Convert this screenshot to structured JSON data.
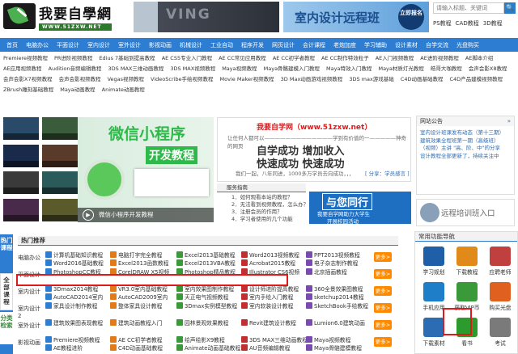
{
  "header": {
    "logo_title": "我要自學網",
    "logo_url": "WWW.51ZXW.NET",
    "banner1_text": "VING",
    "banner2_text": "室内设计远程班",
    "banner2_button": "立即报名",
    "search_placeholder": "请输入标题、关键词",
    "search_icon": "🔍",
    "quicklinks": [
      "PS教程",
      "CAD教程",
      "3D教程"
    ]
  },
  "nav": [
    "首页",
    "电脑办公",
    "平面设计",
    "室内设计",
    "室外设计",
    "影视动画",
    "机械设计",
    "工业自动",
    "程序开发",
    "网页设计",
    "会计课程",
    "老炮加度",
    "学习辅助",
    "设计素材",
    "自学交流",
    "光盘购买"
  ],
  "subnav": [
    "Premiere视频教程",
    "PR进阶视频教程",
    "Edius 7基础到提高教程",
    "AE CS5专业入门教程",
    "AE CC常见应用教程",
    "AE CC初学者教程",
    "AE CC制作特效粒子",
    "AE入门视频教程",
    "AE进阶视频教程",
    "AE脚本介绍",
    "AE应用视频教程",
    "Audition音频编辑教程",
    "3DS MAX三维动画教程",
    "3DS MAX视频教程",
    "Maya视频教程",
    "Maya骨骼建模入门教程",
    "Maya特效入门教程",
    "Maya材质灯光教程",
    "皓哥大咖教程",
    "会声会影X8教程",
    "会声会影X7视频教程",
    "会声会影视频教程",
    "Vegas视频教程",
    "VideoScribe手绘视频教程",
    "Movie Maker视频教程",
    "3D Max动画游戏视频教程",
    "3DS max游戏基础",
    "C4D动画基础教程",
    "C4D产品建模视频教程",
    "ZBrush雕刻基础教程",
    "Maya动画教程",
    "Animate动画教程"
  ],
  "hero": {
    "title": "微信小程序",
    "subtitle": "开发教程",
    "caption": "微信小程序开发教程",
    "play_icon": "▶"
  },
  "promo": {
    "title": "我要自学网（www.51zxw.net）",
    "tagline": "让任何人都可以—————————————学到有价值的一—————神奇的网页",
    "head1": "自学成功  增加收入",
    "head2": "快速成功  快速成功",
    "footer": "我们一起，八年同进，1000多万学员去向成功，，，",
    "link": "[ 分享：学员感言 ]"
  },
  "guide": {
    "heading": "服务指南",
    "items": [
      "1．如何观看本站的教程？",
      "2．无法看到视频教程，怎么办？",
      "3．注册会员的作用？",
      "4．学习者使用的几个功能"
    ],
    "ad_title": "与您同行",
    "ad_sub1": "我要自学网助力大学生",
    "ad_sub2": "开展校园活动"
  },
  "notice": {
    "heading": "网站公告",
    "more": "»",
    "items": [
      "室内设计班课发布动态（第十三期）",
      "建筑效果全程班第一期（高级班）",
      "（视频）主讲 \"高、阶、中\"的分享",
      "设计教程全部更新了，持续关注中"
    ]
  },
  "train": {
    "label": "远程培训班入口",
    "icon": "👤"
  },
  "side": {
    "hot": "热门课程",
    "all": "全部课程",
    "cat": "分类检索"
  },
  "hot": {
    "heading": "热门推荐",
    "more": "更多>",
    "rows": [
      {
        "cat": "电脑办公",
        "items": [
          "计算机基础知识教程",
          "电脑打字完全教程",
          "Excel2013基础教程",
          "Word2013视频教程",
          "PPT2013视频教程"
        ],
        "items2": [
          "Word2016基础教程",
          "Excel2013函数教程",
          "Excel2013VBA教程",
          "Acrobat2015教程",
          "电子杂志制作教程"
        ]
      },
      {
        "cat": "平面设计",
        "items": [
          "PhotoshopCC教程",
          "CorelDRAW X5视频",
          "Photoshop精品教程",
          "Illustrator CS6视频",
          "北京插画教程"
        ],
        "items2": []
      },
      {
        "cat": "室内设计",
        "items": [
          "3Dmax2014教程",
          "VR3.0室内基础教程",
          "室内效果图制作教程",
          "设计师进阶提高教程",
          "360全景效果图教程"
        ],
        "items2": [
          "AutoCAD2014室内",
          "AutoCAD2009室内",
          "天正电气视频教程",
          "室内手绘入门教程",
          "sketchup2014教程"
        ]
      },
      {
        "cat": "室内设计2",
        "items": [
          "家具设计制作教程",
          "整体家具设计教程",
          "3Dmax实例模型教程",
          "室内软装设计教程",
          "SketchBook手绘教程"
        ],
        "items2": []
      },
      {
        "cat": "室外设计",
        "items": [
          "建筑效果图表现教程",
          "建筑动画教程入门",
          "园林景观效果教程",
          "Revit建筑设计教程",
          "Lumion6.0建筑动画"
        ],
        "items2": []
      },
      {
        "cat": "影视动画",
        "items": [
          "Premiere视频教程",
          "AE CC初学者教程",
          "绘声绘影X9教程",
          "3DS MAX三维动画教程",
          "Maya视频教程"
        ],
        "items2": [
          "AE教程进阶",
          "C4D动画基础教程",
          "Animate动画基础教程",
          "AU音频编辑教程",
          "Maya骨骼建模教程"
        ]
      }
    ]
  },
  "quick": {
    "heading": "常用功能导航",
    "items": [
      "学习规划",
      "下载教程",
      "应聘老师",
      "手机应用",
      "获取VIP币",
      "购买光盘",
      "下载素材",
      "看书",
      "考试"
    ]
  },
  "colors": {
    "nav": "#2d7dd2",
    "highlight": "#e01a1a",
    "more": "#ff8a00",
    "hero_green": "#2fb94a"
  }
}
